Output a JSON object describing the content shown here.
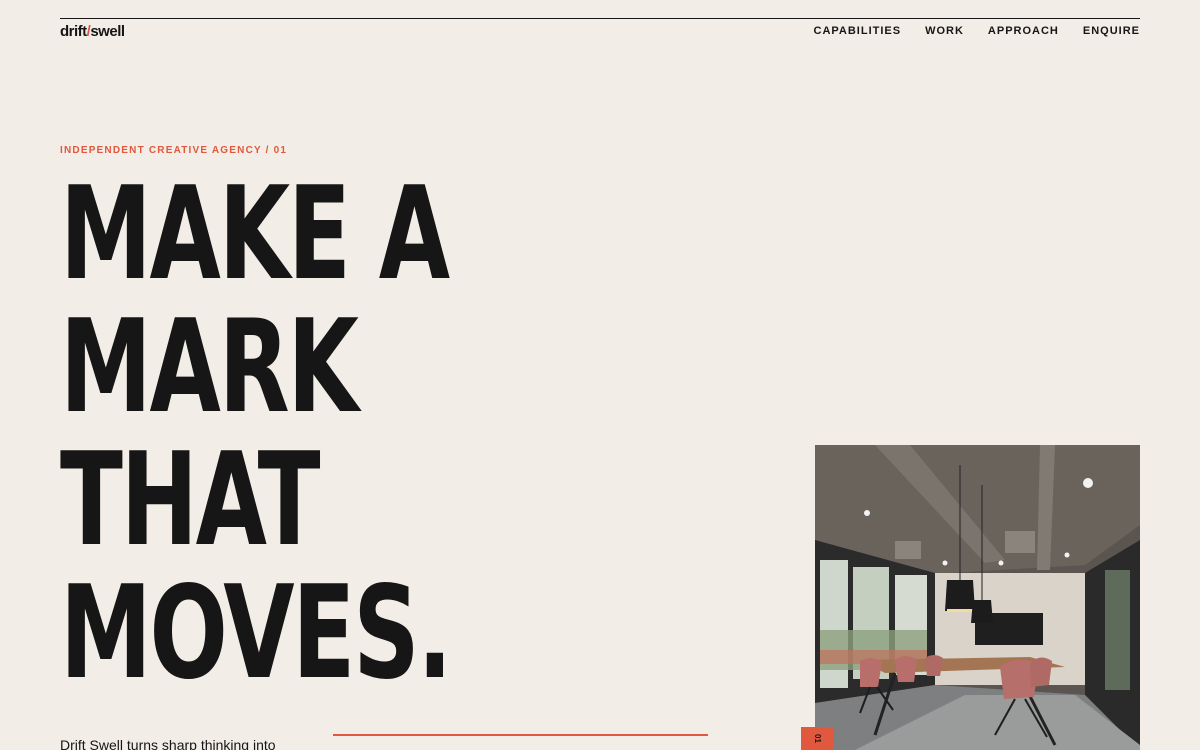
{
  "brand": {
    "logo_left": "drift",
    "logo_slash": "/",
    "logo_right": "swell",
    "accent_color": "#e0583e",
    "background_color": "#f2ede7",
    "ink_color": "#161616"
  },
  "nav": {
    "items": [
      {
        "label": "CAPABILITIES"
      },
      {
        "label": "WORK"
      },
      {
        "label": "APPROACH"
      },
      {
        "label": "ENQUIRE"
      }
    ]
  },
  "hero": {
    "eyebrow": "INDEPENDENT CREATIVE AGENCY / 01",
    "headline_lines": [
      "MAKE A",
      "MARK",
      "THAT",
      "MOVES."
    ],
    "intro": "Drift Swell turns sharp thinking into",
    "side_tab": "01"
  }
}
